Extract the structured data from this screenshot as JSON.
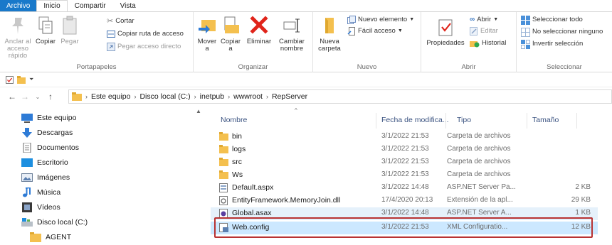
{
  "tabs": [
    "Archivo",
    "Inicio",
    "Compartir",
    "Vista"
  ],
  "ribbon": {
    "portapapeles": {
      "label": "Portapapeles",
      "anclar": "Anclar al acceso rápido",
      "copiar": "Copiar",
      "pegar": "Pegar",
      "cortar": "Cortar",
      "copiar_ruta": "Copiar ruta de acceso",
      "pegar_acceso": "Pegar acceso directo"
    },
    "organizar": {
      "label": "Organizar",
      "mover": "Mover a",
      "copiar_a": "Copiar a",
      "eliminar": "Eliminar",
      "cambiar_nombre": "Cambiar nombre"
    },
    "nuevo": {
      "label": "Nuevo",
      "nueva_carpeta": "Nueva carpeta",
      "nuevo_elemento": "Nuevo elemento",
      "facil_acceso": "Fácil acceso"
    },
    "abrir": {
      "label": "Abrir",
      "propiedades": "Propiedades",
      "abrir": "Abrir",
      "editar": "Editar",
      "historial": "Historial"
    },
    "seleccionar": {
      "label": "Seleccionar",
      "todo": "Seleccionar todo",
      "ninguno": "No seleccionar ninguno",
      "invertir": "Invertir selección"
    }
  },
  "address": {
    "crumbs": [
      "Este equipo",
      "Disco local (C:)",
      "inetpub",
      "wwwroot",
      "RepServer"
    ]
  },
  "nav": {
    "items": [
      "Este equipo",
      "Descargas",
      "Documentos",
      "Escritorio",
      "Imágenes",
      "Música",
      "Vídeos",
      "Disco local (C:)",
      "AGENT"
    ]
  },
  "columns": {
    "name": "Nombre",
    "date": "Fecha de modifica...",
    "type": "Tipo",
    "size": "Tamaño"
  },
  "files": [
    {
      "name": "bin",
      "date": "3/1/2022 21:53",
      "type": "Carpeta de archivos",
      "size": "",
      "icon": "folder-icon"
    },
    {
      "name": "logs",
      "date": "3/1/2022 21:53",
      "type": "Carpeta de archivos",
      "size": "",
      "icon": "folder-icon"
    },
    {
      "name": "src",
      "date": "3/1/2022 21:53",
      "type": "Carpeta de archivos",
      "size": "",
      "icon": "folder-icon"
    },
    {
      "name": "Ws",
      "date": "3/1/2022 21:53",
      "type": "Carpeta de archivos",
      "size": "",
      "icon": "folder-icon"
    },
    {
      "name": "Default.aspx",
      "date": "3/1/2022 14:48",
      "type": "ASP.NET Server Pa...",
      "size": "2 KB",
      "icon": "aspx-file-icon"
    },
    {
      "name": "EntityFramework.MemoryJoin.dll",
      "date": "17/4/2020 20:13",
      "type": "Extensión de la apl...",
      "size": "29 KB",
      "icon": "dll-file-icon"
    },
    {
      "name": "Global.asax",
      "date": "3/1/2022 14:48",
      "type": "ASP.NET Server A...",
      "size": "1 KB",
      "icon": "asax-file-icon"
    },
    {
      "name": "Web.config",
      "date": "3/1/2022 21:53",
      "type": "XML Configuratio...",
      "size": "12 KB",
      "icon": "config-file-icon"
    }
  ],
  "colors": {
    "file_tab": "#1979ca",
    "folder": "#f4c04f",
    "highlight_border": "#b83232",
    "header_text": "#3a5280"
  }
}
